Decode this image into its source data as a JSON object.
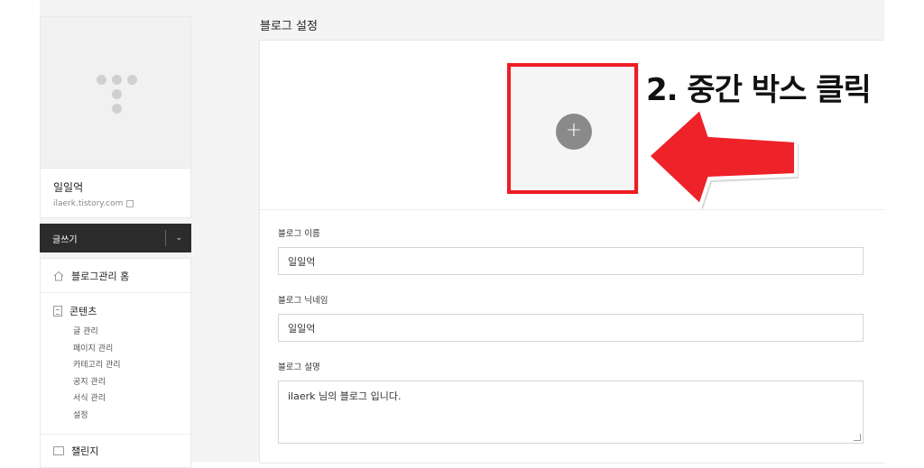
{
  "sidebar": {
    "blog_name": "일일억",
    "blog_url": "ilaerk.tistory.com",
    "write_button": "글쓰기",
    "menu": {
      "home": "블로그관리 홈",
      "content_section": "콘텐츠",
      "content_items": [
        "글 관리",
        "페이지 관리",
        "카테고리 관리",
        "공지 관리",
        "서식 관리",
        "설정"
      ],
      "challenge": "챌린지"
    }
  },
  "main": {
    "page_title": "블로그 설정",
    "upload_plus": "+",
    "annotation_text": "2. 중간 박스 클릭",
    "annotation_color": "#ee1c24",
    "fields": {
      "name_label": "블로그 이름",
      "name_value": "일일억",
      "nickname_label": "블로그 닉네임",
      "nickname_value": "일일억",
      "description_label": "블로그 설명",
      "description_value": "ilaerk 님의 블로그 입니다."
    }
  }
}
